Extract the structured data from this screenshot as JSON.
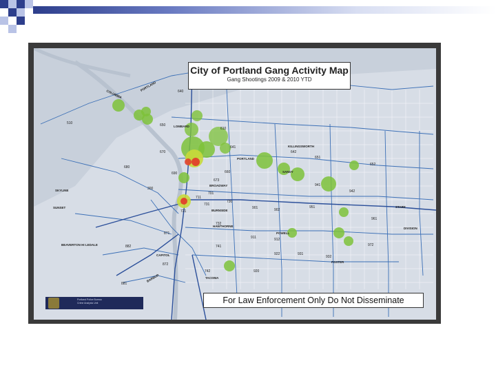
{
  "slide": {
    "bullet_color": "#2d3e8c",
    "accent_color": "#b9c3e6"
  },
  "map": {
    "title": "City of Portland Gang Activity Map",
    "subtitle": "Gang Shootings 2009 & 2010 YTD",
    "warning": "For Law Enforcement Only Do Not Disseminate",
    "badge_line1": "Portland Police Bureau",
    "badge_line2": "Crime Analysis Unit",
    "seal_icon": "police-seal-icon",
    "hotspot_colors": {
      "low": "#7ec23a",
      "mid": "#c8d93a",
      "high": "#e2372a"
    },
    "district_labels": [
      "510",
      "640",
      "650",
      "670",
      "680",
      "610",
      "641",
      "642",
      "651",
      "652",
      "673",
      "660",
      "690",
      "711",
      "300",
      "731",
      "730",
      "701",
      "901",
      "902",
      "951",
      "961",
      "721",
      "741",
      "732",
      "911",
      "912",
      "922",
      "931",
      "932",
      "941",
      "942",
      "972",
      "871",
      "882",
      "872",
      "881",
      "920",
      "742"
    ],
    "street_labels": [
      "COLUMBIA",
      "PORTLAND",
      "LOMBARD",
      "PORTLAND",
      "KILLINGSWORTH",
      "SKYLINE",
      "BROADWAY",
      "BURNSIDE",
      "HAWTHORNE",
      "DIVISION",
      "POWELL",
      "FOSTER",
      "TACOMA",
      "SANDY",
      "STARK",
      "BEAVERTON HI LEDALE",
      "SUNSET",
      "CAPITOL",
      "BARBUR"
    ]
  }
}
